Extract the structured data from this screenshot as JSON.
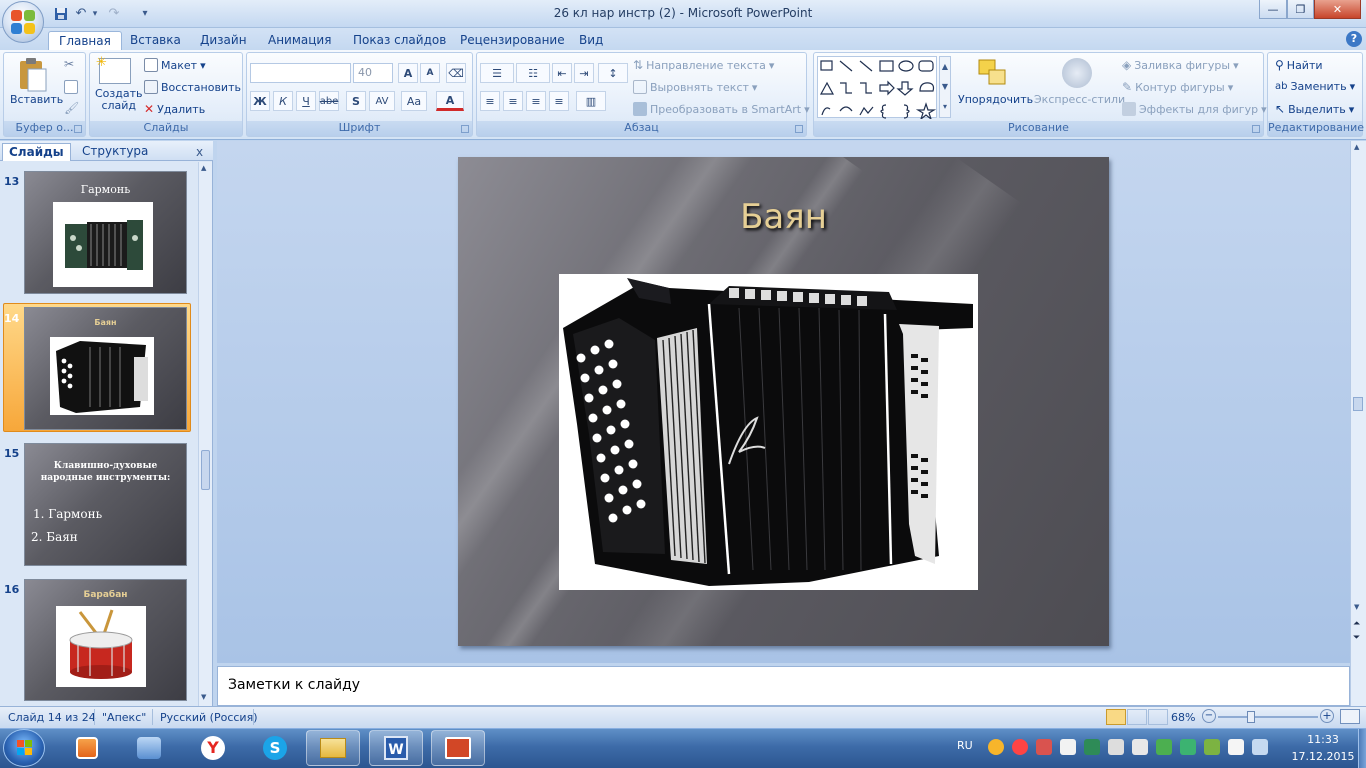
{
  "window": {
    "title": "26 кл нар инстр (2) - Microsoft PowerPoint",
    "minimize": "—",
    "maximize": "❐",
    "close": "✕"
  },
  "qat": {
    "save_icon": "save-icon",
    "undo": "↶",
    "redo": "↷",
    "customize": "▾"
  },
  "tabs": [
    "Главная",
    "Вставка",
    "Дизайн",
    "Анимация",
    "Показ слайдов",
    "Рецензирование",
    "Вид"
  ],
  "active_tab": "Главная",
  "ribbon": {
    "clipboard": {
      "paste": "Вставить",
      "label": "Буфер о..."
    },
    "slides": {
      "new_slide": "Создать\nслайд",
      "layout": "Макет",
      "reset": "Восстановить",
      "delete": "Удалить",
      "label": "Слайды"
    },
    "font": {
      "font_size": "40",
      "bold": "Ж",
      "italic": "К",
      "underline": "Ч",
      "strike": "abe",
      "shadow": "S",
      "spacing": "AV",
      "case": "Aa",
      "color": "A",
      "grow": "A",
      "shrink": "A",
      "label": "Шрифт"
    },
    "paragraph": {
      "text_direction": "Направление текста",
      "align_text": "Выровнять текст",
      "smartart": "Преобразовать в SmartArt",
      "label": "Абзац"
    },
    "drawing": {
      "arrange": "Упорядочить",
      "quick_styles": "Экспресс-стили",
      "fill": "Заливка фигуры",
      "outline": "Контур фигуры",
      "effects": "Эффекты для фигур",
      "label": "Рисование"
    },
    "editing": {
      "find": "Найти",
      "replace": "Заменить",
      "select": "Выделить",
      "label": "Редактирование"
    }
  },
  "panel": {
    "tabs": [
      "Слайды",
      "Структура"
    ],
    "close": "x",
    "slides": [
      {
        "num": "13",
        "title": "Гармонь"
      },
      {
        "num": "14",
        "title": "Баян"
      },
      {
        "num": "15",
        "title": "Клавишно-духовые народные инструменты:",
        "items": [
          "1. Гармонь",
          "2. Баян"
        ]
      },
      {
        "num": "16",
        "title": "Барабан"
      }
    ]
  },
  "slide": {
    "title": "Баян"
  },
  "notes": {
    "placeholder": "Заметки к слайду"
  },
  "status": {
    "slide_info": "Слайд 14 из 24",
    "theme": "\"Апекс\"",
    "language": "Русский (Россия)",
    "zoom": "68%",
    "zoom_minus": "−",
    "zoom_plus": "+"
  },
  "taskbar": {
    "lang": "RU",
    "time": "11:33",
    "date": "17.12.2015"
  },
  "colors": {
    "ribbon_text": "#15428b",
    "slide_title": "#e6cf95",
    "selection": "#f7a73a",
    "taskbar": "#3d6ba8"
  }
}
